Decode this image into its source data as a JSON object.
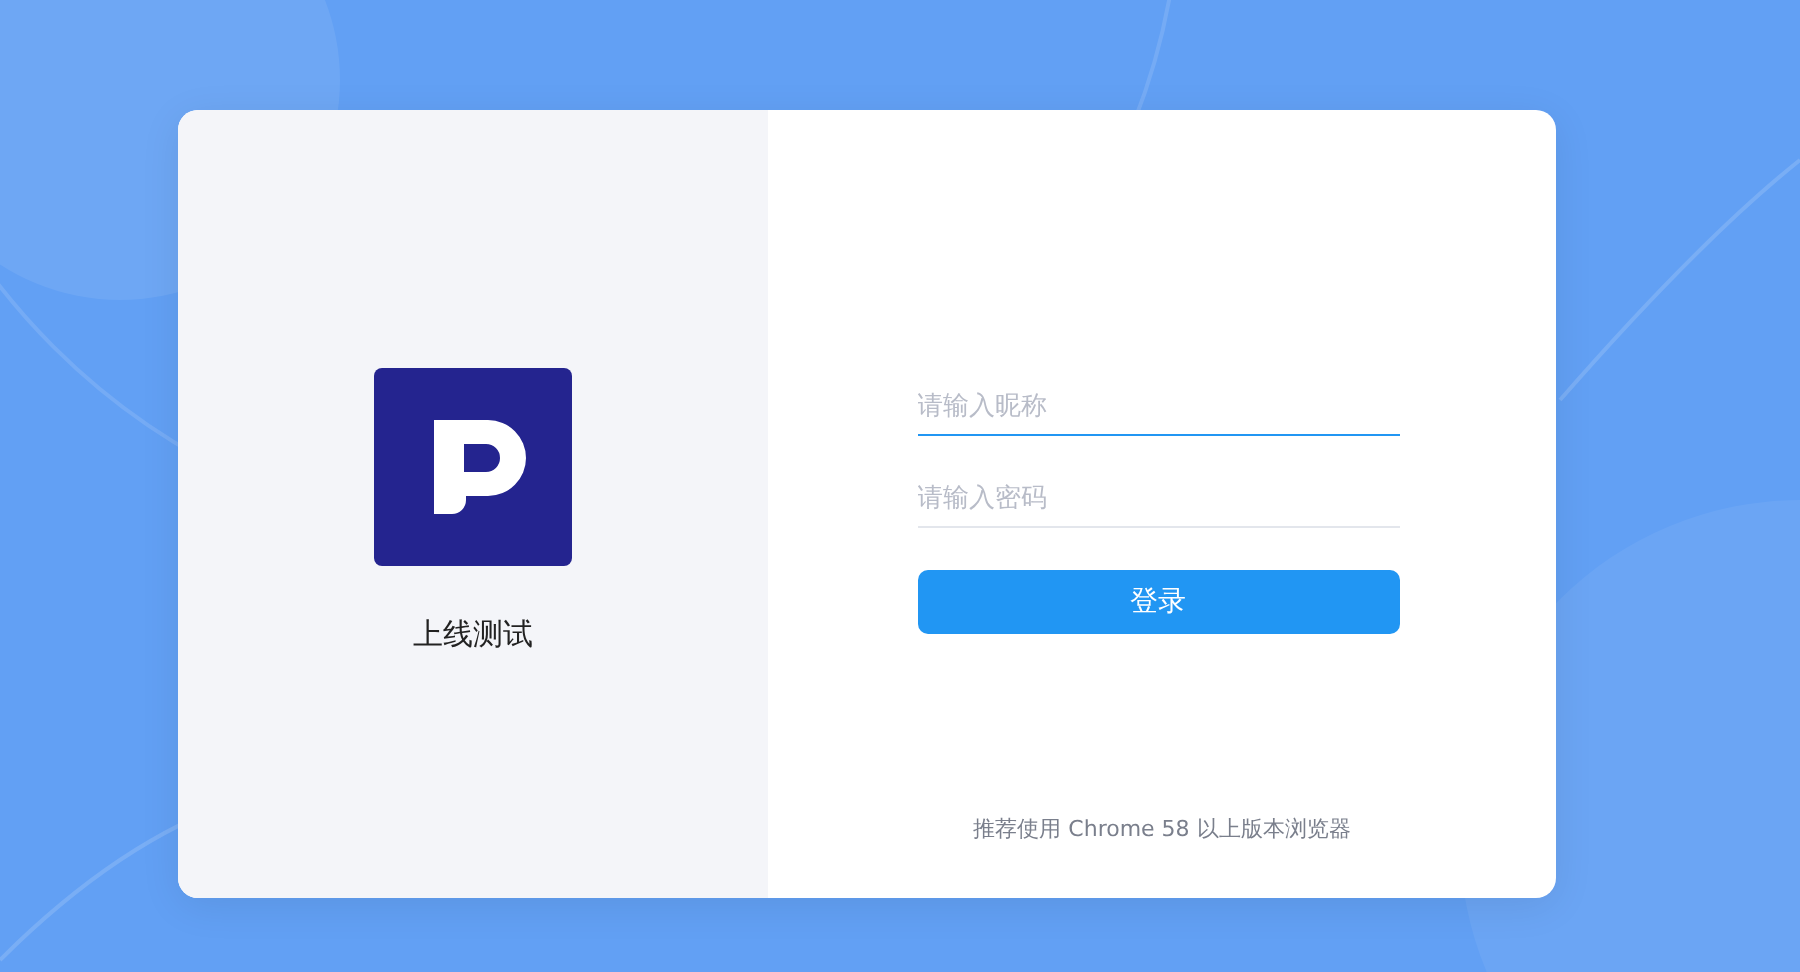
{
  "brand": {
    "title": "上线测试"
  },
  "fields": [
    {
      "placeholder": "请输入昵称",
      "focused": true
    },
    {
      "placeholder": "请输入密码",
      "focused": false
    }
  ],
  "login_button": {
    "label": "登录"
  },
  "footer_note": "推荐使用 Chrome 58 以上版本浏览器"
}
